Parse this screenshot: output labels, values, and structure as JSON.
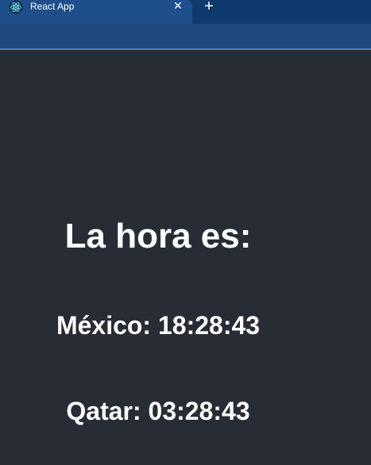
{
  "browser": {
    "tab_title": "React App",
    "tab_close_glyph": "✕",
    "new_tab_glyph": "+",
    "tab_icon": "react-logo-icon"
  },
  "page": {
    "heading": "La hora es:",
    "times": [
      {
        "label": "México: 18:28:43"
      },
      {
        "label": "Qatar: 03:28:43"
      }
    ]
  },
  "colors": {
    "background": "#282c34",
    "tab_strip": "#0f3a6e",
    "tab_active": "#1e4f8c",
    "text": "#ffffff"
  }
}
